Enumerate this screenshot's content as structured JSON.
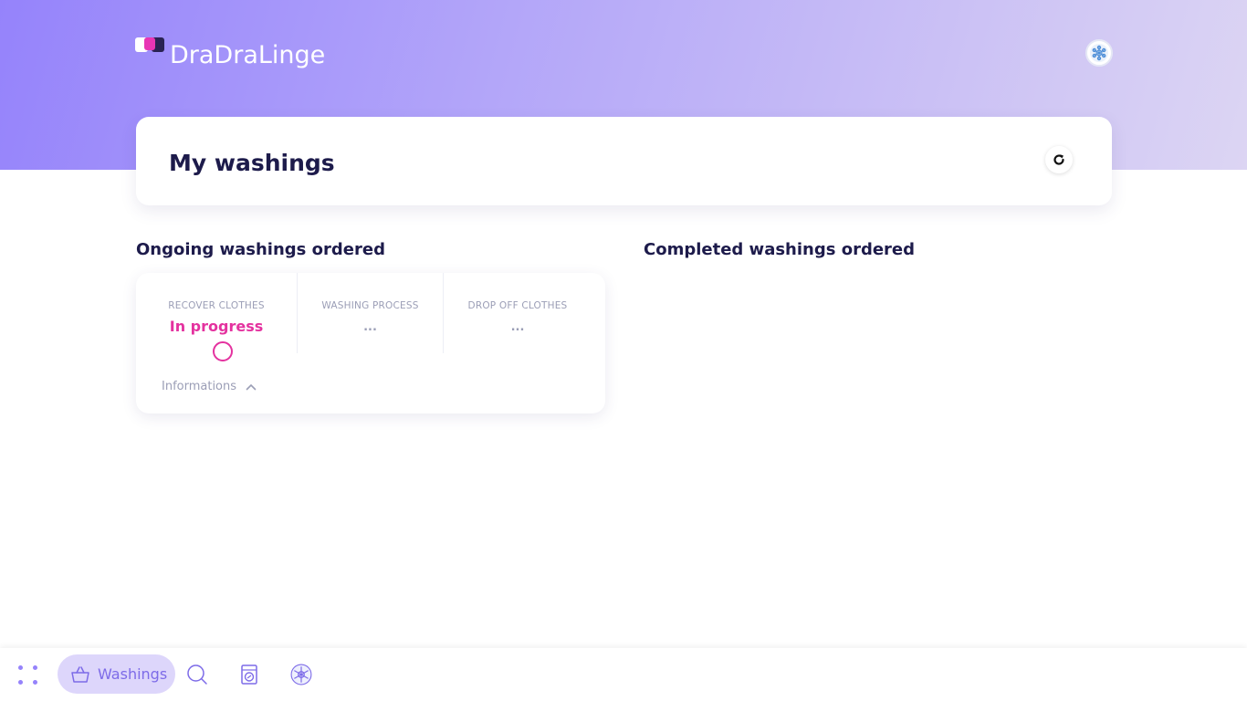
{
  "brand": {
    "name": "DraDraLinge"
  },
  "colors": {
    "accent": "#9583fb",
    "status_in_progress": "#e4329f",
    "title": "#1d1b4b",
    "muted": "#9b9eb6"
  },
  "header": {
    "avatar_icon": "snowflake-avatar-icon"
  },
  "page": {
    "title": "My washings",
    "refresh_icon": "refresh-icon"
  },
  "sections": {
    "ongoing_title": "Ongoing washings ordered",
    "completed_title": "Completed washings ordered"
  },
  "order": {
    "steps": [
      {
        "label": "RECOVER CLOTHES",
        "value": "In progress"
      },
      {
        "label": "WASHING PROCESS",
        "value": "..."
      },
      {
        "label": "DROP OFF CLOTHES",
        "value": "..."
      }
    ],
    "info_label": "Informations"
  },
  "bottom_nav": {
    "items": [
      {
        "icon": "apps-grid-icon"
      },
      {
        "icon": "basket-icon",
        "label": "Washings",
        "active": true
      },
      {
        "icon": "search-icon"
      },
      {
        "icon": "washing-machine-icon"
      },
      {
        "icon": "snowflake-avatar-icon"
      }
    ]
  }
}
